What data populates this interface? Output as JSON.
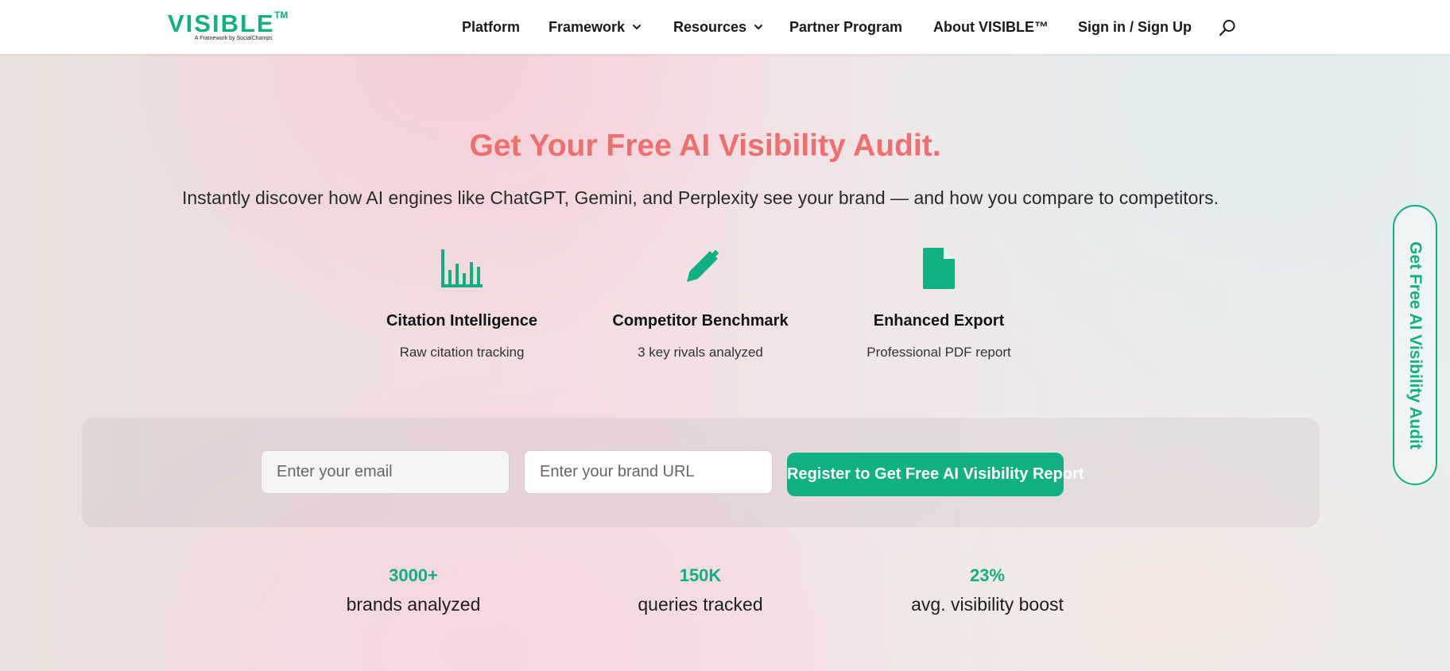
{
  "header": {
    "logo": {
      "word": "VISIBLE",
      "tm": "TM",
      "tagline": "A Framework by SocialChamps"
    },
    "nav": {
      "platform": "Platform",
      "framework": "Framework",
      "resources": "Resources",
      "partner": "Partner Program",
      "about": "About VISIBLE™",
      "signin": "Sign in / Sign Up"
    },
    "icons": {
      "dropdown": "chevron-down-icon",
      "search": "search-icon"
    }
  },
  "hero": {
    "title": "Get Your Free AI Visibility Audit.",
    "subtitle": "Instantly discover how AI engines like ChatGPT, Gemini, and Perplexity see your brand — and how you compare to competitors."
  },
  "features": [
    {
      "icon": "bar-chart-icon",
      "title": "Citation Intelligence",
      "desc": "Raw citation tracking"
    },
    {
      "icon": "pen-icon",
      "title": "Competitor Benchmark",
      "desc": "3 key rivals analyzed"
    },
    {
      "icon": "document-icon",
      "title": "Enhanced Export",
      "desc": "Professional PDF report"
    }
  ],
  "form": {
    "email_placeholder": "Enter your email",
    "url_placeholder": "Enter your brand URL",
    "submit_label": "Register to Get Free AI Visibility Report"
  },
  "stats": [
    {
      "value": "3000+",
      "label": "brands analyzed"
    },
    {
      "value": "150K",
      "label": "queries tracked"
    },
    {
      "value": "23%",
      "label": "avg. visibility boost"
    }
  ],
  "side_tab": {
    "label": "Get Free AI Visibility Audit"
  },
  "colors": {
    "brand": "#10b083",
    "title": "#ee6f6c"
  }
}
